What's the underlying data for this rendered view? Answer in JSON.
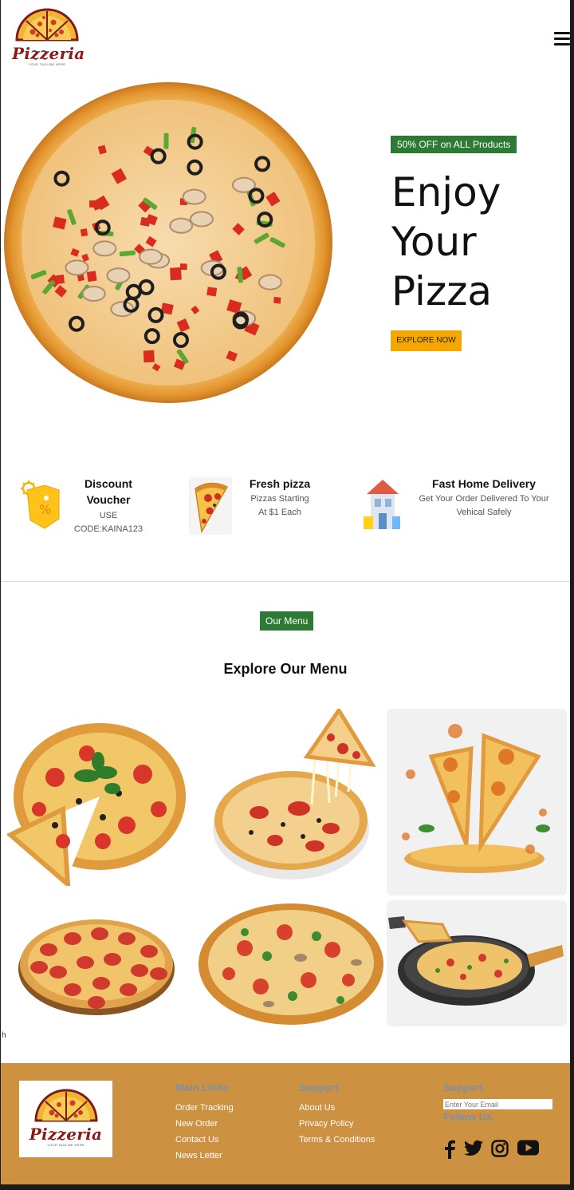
{
  "header": {
    "brand": "Pizzeria",
    "tagline": "YOUR TAGLINE HERE"
  },
  "hero": {
    "badge": "50% OFF on ALL Products",
    "title_lines": [
      "Enjoy",
      "Your",
      "Pizza"
    ],
    "cta": "EXPLORE NOW"
  },
  "features": [
    {
      "icon": "discount-tag-icon",
      "title_lines": [
        "Discount",
        "Voucher"
      ],
      "text_lines": [
        "USE",
        "CODE:KAINA123"
      ]
    },
    {
      "icon": "pizza-slice-icon",
      "title_lines": [
        "Fresh pizza"
      ],
      "text_lines": [
        "Pizzas Starting",
        "At $1 Each"
      ]
    },
    {
      "icon": "house-icon",
      "title_lines": [
        "Fast Home Delivery"
      ],
      "text_lines": [
        "Get Your Order Delivered To Your",
        "Vehical Safely"
      ]
    }
  ],
  "menu": {
    "badge": "Our Menu",
    "title": "Explore Our Menu"
  },
  "stray_text": "h",
  "footer": {
    "brand": "Pizzeria",
    "tagline": "YOUR TAGLINE HERE",
    "main_links": {
      "heading": "Main Links",
      "items": [
        "Order Tracking",
        "New Order",
        "Contact Us",
        "News Letter"
      ]
    },
    "support_links": {
      "heading": "Support",
      "items": [
        "About Us",
        "Privacy Policy",
        "Terms & Conditions"
      ]
    },
    "newsletter": {
      "heading": "Support",
      "email_placeholder": "Enter Your Email",
      "follow_heading": "Follow Us"
    },
    "socials": [
      "facebook-icon",
      "twitter-icon",
      "instagram-icon",
      "youtube-icon"
    ]
  },
  "colors": {
    "accent_green": "#2d7a34",
    "cta_orange": "#f7a600",
    "footer_bg": "#cc9141",
    "brand_red": "#8a1a18"
  }
}
